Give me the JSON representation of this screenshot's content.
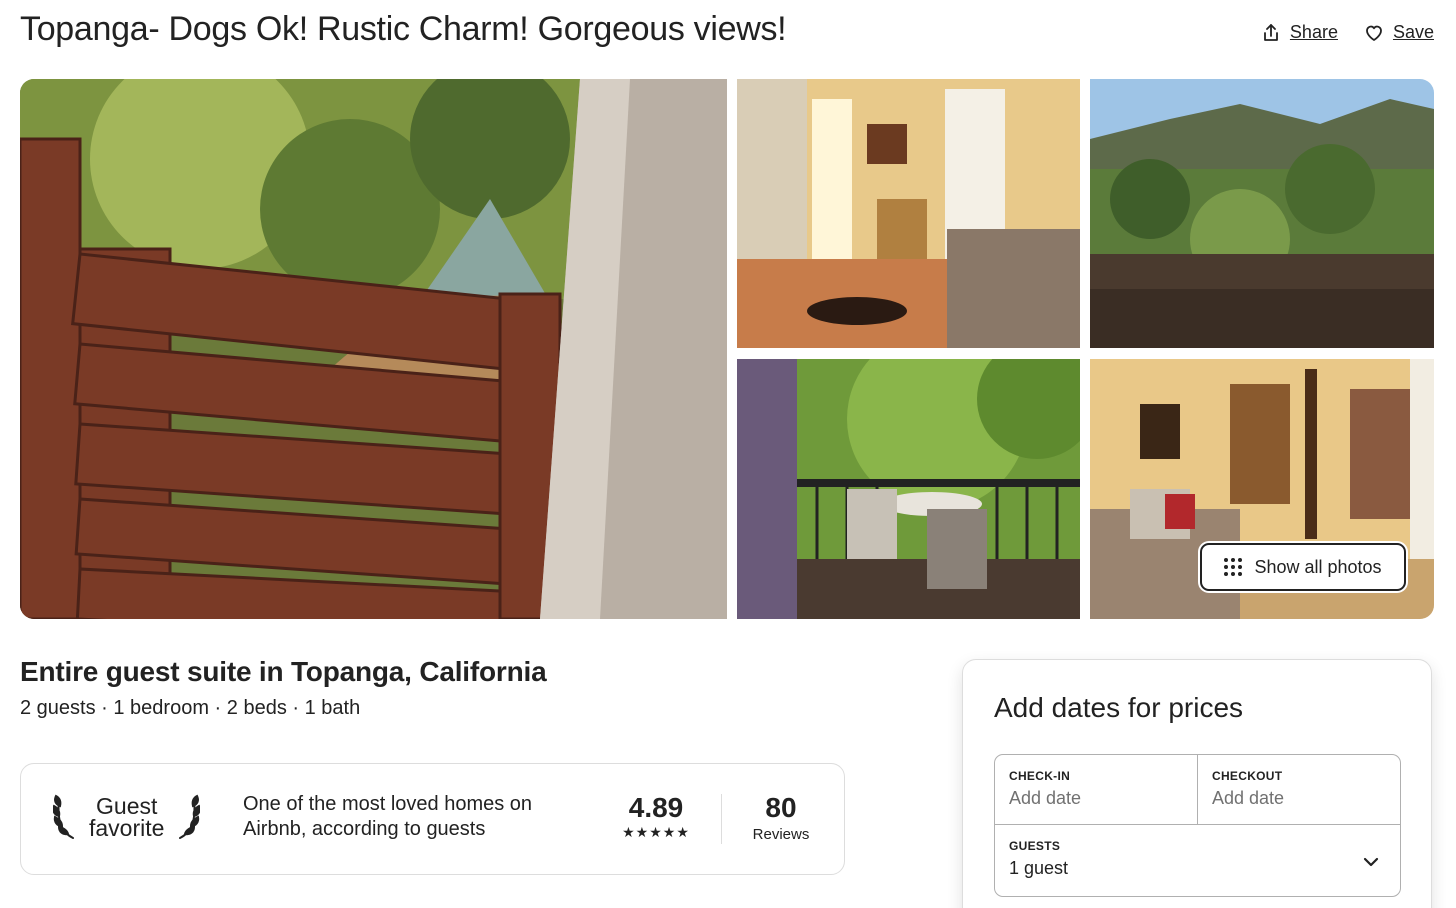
{
  "header": {
    "title": "Topanga- Dogs Ok! Rustic Charm! Gorgeous views!",
    "share_label": "Share",
    "save_label": "Save"
  },
  "gallery": {
    "show_all_label": "Show all photos",
    "photos": [
      {
        "subject": "wooden gate and hillside garden"
      },
      {
        "subject": "guest suite interior with dog on tile floor"
      },
      {
        "subject": "canyon view from deck railing"
      },
      {
        "subject": "balcony with patio table and chairs"
      },
      {
        "subject": "bedroom with daybed and wall art"
      }
    ]
  },
  "listing": {
    "subtitle": "Entire guest suite in Topanga, California",
    "details": "2 guests · 1 bedroom · 2 beds · 1 bath"
  },
  "guest_favorite": {
    "badge_line1": "Guest",
    "badge_line2": "favorite",
    "description": "One of the most loved homes on Airbnb, according to guests",
    "rating": "4.89",
    "stars": "★★★★★",
    "reviews_count": "80",
    "reviews_label": "Reviews"
  },
  "booking": {
    "title": "Add dates for prices",
    "checkin_label": "CHECK-IN",
    "checkin_value": "Add date",
    "checkout_label": "CHECKOUT",
    "checkout_value": "Add date",
    "guests_label": "GUESTS",
    "guests_value": "1 guest"
  },
  "icons": {
    "share": "share-icon",
    "save": "heart-icon",
    "grid": "grid-icon",
    "laurel": "laurel-icon",
    "chevron": "chevron-down-icon"
  }
}
